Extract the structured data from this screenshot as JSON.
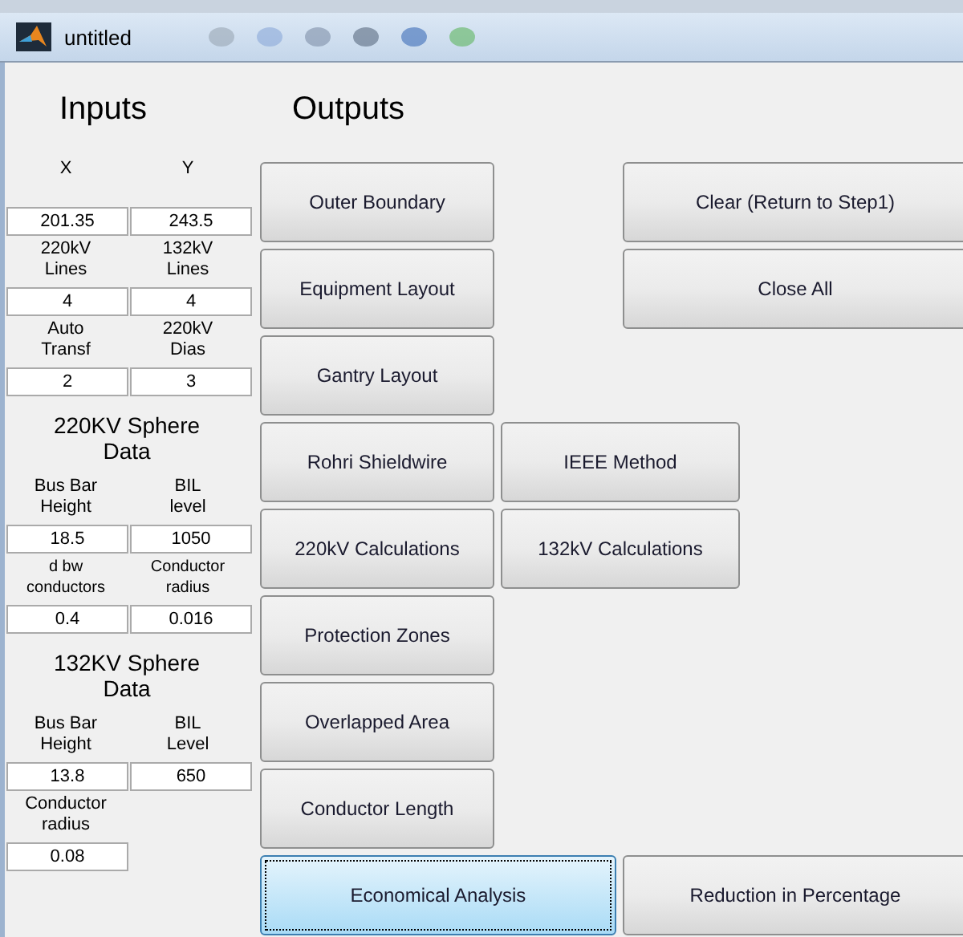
{
  "window": {
    "title": "untitled"
  },
  "inputs": {
    "title": "Inputs",
    "rows": [
      {
        "kind": "labels",
        "cells": [
          "X",
          "Y"
        ]
      },
      {
        "kind": "fields",
        "cells": [
          "201.35",
          "243.5"
        ]
      },
      {
        "kind": "labels",
        "cells": [
          "220kV\nLines",
          "132kV\nLines"
        ]
      },
      {
        "kind": "fields",
        "cells": [
          "4",
          "4"
        ]
      },
      {
        "kind": "labels",
        "cells": [
          "Auto\nTransf",
          "220kV\nDias"
        ]
      },
      {
        "kind": "fields",
        "cells": [
          "2",
          "3"
        ]
      },
      {
        "kind": "heading",
        "cells": [
          "220KV Sphere\nData"
        ]
      },
      {
        "kind": "labels",
        "cells": [
          "Bus Bar\nHeight",
          "BIL\nlevel"
        ]
      },
      {
        "kind": "fields",
        "cells": [
          "18.5",
          "1050"
        ]
      },
      {
        "kind": "small-labels",
        "cells": [
          "d bw\nconductors",
          "Conductor\nradius"
        ]
      },
      {
        "kind": "fields",
        "cells": [
          "0.4",
          "0.016"
        ]
      },
      {
        "kind": "heading",
        "cells": [
          "132KV Sphere\nData"
        ]
      },
      {
        "kind": "labels",
        "cells": [
          "Bus Bar\nHeight",
          "BIL\nLevel"
        ]
      },
      {
        "kind": "fields",
        "cells": [
          "13.8",
          "650"
        ]
      },
      {
        "kind": "labels",
        "cells": [
          "Conductor\nradius"
        ]
      },
      {
        "kind": "fields",
        "cells": [
          "0.08"
        ]
      }
    ]
  },
  "outputs": {
    "title": "Outputs",
    "buttons": [
      {
        "label": "Outer Boundary",
        "focused": false
      },
      {
        "label": "Equipment Layout",
        "focused": false
      },
      {
        "label": "Gantry Layout",
        "focused": false
      },
      {
        "label": "Rohri Shieldwire",
        "focused": false
      },
      {
        "label": "220kV Calculations",
        "focused": false
      },
      {
        "label": "Protection Zones",
        "focused": false
      },
      {
        "label": "Overlapped Area",
        "focused": false
      },
      {
        "label": "Conductor Length",
        "focused": false
      }
    ],
    "methods": [
      {
        "label": "IEEE Method",
        "focused": false
      },
      {
        "label": "132kV Calculations",
        "focused": false
      }
    ],
    "actions": [
      {
        "label": "Clear (Return to Step1)",
        "focused": false
      },
      {
        "label": "Close All",
        "focused": false
      }
    ],
    "bottom": [
      {
        "label": "Economical Analysis",
        "focused": true
      },
      {
        "label": "Reduction in Percentage",
        "focused": false
      }
    ]
  }
}
